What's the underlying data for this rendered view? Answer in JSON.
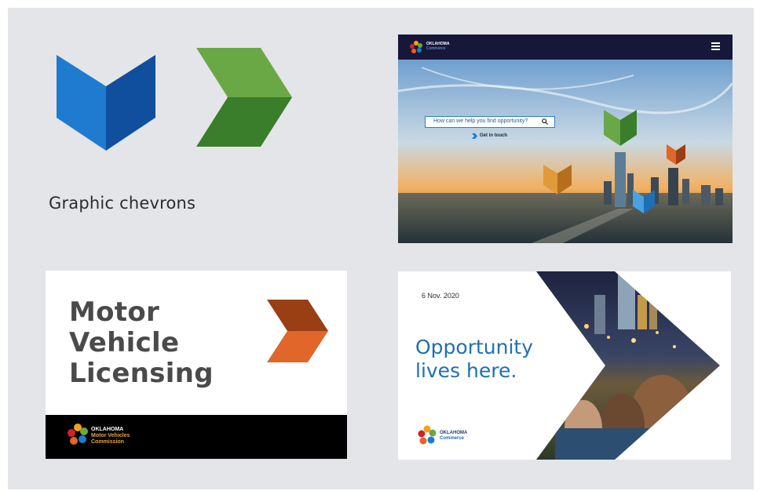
{
  "caption": "Graphic chevrons",
  "colors": {
    "board": "#e4e5e8",
    "blue_light": "#1e7bd0",
    "blue_dark": "#0f4f9e",
    "green_light": "#6aa845",
    "green_dark": "#3a7d2a",
    "orange_light": "#e0662a",
    "orange_dark": "#9a3e13",
    "nav": "#17173a",
    "opportunity_blue": "#1f6fb3"
  },
  "web": {
    "logo_line1": "OKLAHOMA",
    "logo_line2": "Commerce",
    "menu_icon": "hamburger-menu-icon",
    "search_placeholder": "How can we help you find opportunity?",
    "search_icon": "search-icon",
    "cta": "Get in touch"
  },
  "mvl": {
    "title_lines": [
      "Motor",
      "Vehicle",
      "Licensing"
    ],
    "logo_line1": "OKLAHOMA",
    "logo_line2": "Motor Vehicles",
    "logo_line3": "Commission"
  },
  "opportunity": {
    "date": "6 Nov. 2020",
    "headline_line1": "Opportunity",
    "headline_line2": "lives here.",
    "logo_line1": "OKLAHOMA",
    "logo_line2": "Commerce"
  }
}
